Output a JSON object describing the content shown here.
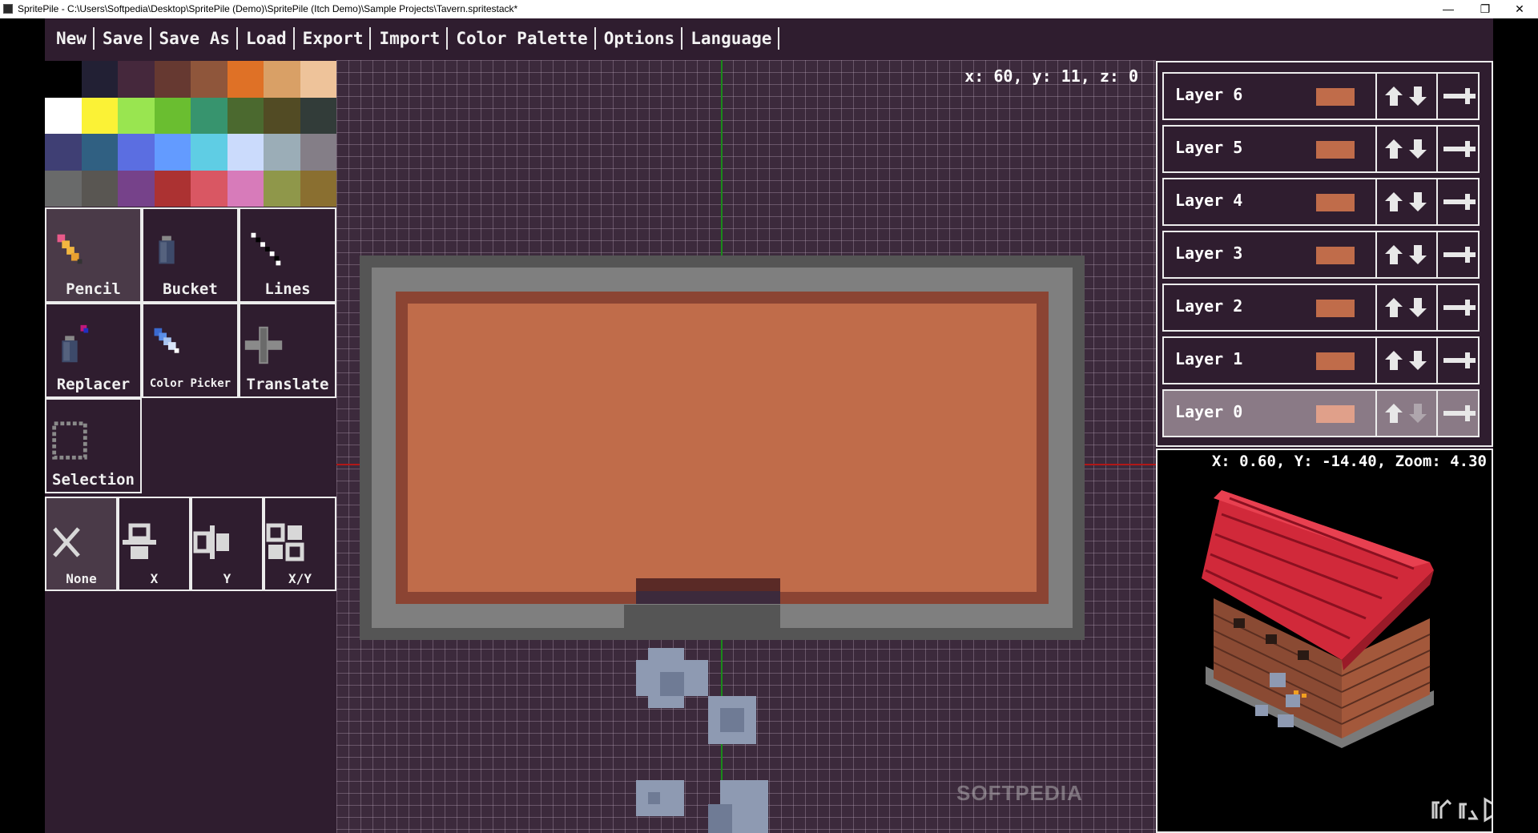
{
  "window": {
    "title": "SpritePile - C:\\Users\\Softpedia\\Desktop\\SpritePile (Demo)\\SpritePile (Itch Demo)\\Sample Projects\\Tavern.spritestack*",
    "minimize": "—",
    "maximize": "❐",
    "close": "✕"
  },
  "menu": [
    "New",
    "Save",
    "Save As",
    "Load",
    "Export",
    "Import",
    "Color Palette",
    "Options",
    "Language"
  ],
  "palette": [
    "#000000",
    "#222034",
    "#45283c",
    "#663931",
    "#8f563b",
    "#df7126",
    "#d9a066",
    "#eec39a",
    "#ffffff",
    "#fbf236",
    "#99e550",
    "#6abe30",
    "#37946e",
    "#4b692f",
    "#524b24",
    "#323c39",
    "#3f3f74",
    "#306082",
    "#5b6ee1",
    "#639bff",
    "#5fcde4",
    "#cbdbfc",
    "#9badb7",
    "#847e87",
    "#696a6a",
    "#595652",
    "#76428a",
    "#ac3232",
    "#d95763",
    "#d77bba",
    "#8f974a",
    "#8a6f30"
  ],
  "tools": [
    {
      "label": "Pencil",
      "icon": "pencil-icon",
      "selected": true
    },
    {
      "label": "Bucket",
      "icon": "bucket-icon",
      "selected": false
    },
    {
      "label": "Lines",
      "icon": "lines-icon",
      "selected": false
    },
    {
      "label": "Replacer",
      "icon": "replacer-icon",
      "selected": false
    },
    {
      "label": "Color Picker",
      "icon": "color-picker-icon",
      "selected": false
    },
    {
      "label": "Translate",
      "icon": "translate-icon",
      "selected": false
    },
    {
      "label": "Selection",
      "icon": "selection-icon",
      "selected": false
    }
  ],
  "mirror": [
    {
      "label": "None",
      "icon": "mirror-none-icon",
      "selected": true
    },
    {
      "label": "X",
      "icon": "mirror-x-icon",
      "selected": false
    },
    {
      "label": "Y",
      "icon": "mirror-y-icon",
      "selected": false
    },
    {
      "label": "X/Y",
      "icon": "mirror-xy-icon",
      "selected": false
    }
  ],
  "canvas": {
    "coords": "x: 60, y: 11, z: 0",
    "watermark": "SOFTPEDIA"
  },
  "layers": [
    {
      "name": "Layer 6",
      "selected": false
    },
    {
      "name": "Layer 5",
      "selected": false
    },
    {
      "name": "Layer 4",
      "selected": false
    },
    {
      "name": "Layer 3",
      "selected": false
    },
    {
      "name": "Layer 2",
      "selected": false
    },
    {
      "name": "Layer 1",
      "selected": false
    },
    {
      "name": "Layer 0",
      "selected": true
    }
  ],
  "preview": {
    "status": "X: 0.60, Y: -14.40, Zoom: 4.30"
  },
  "colors": {
    "bg": "#2f1d2f",
    "grid_bg": "#3c2a3c",
    "floor": "#c06c4a",
    "border": "#8b4433",
    "roof": "#d1293a"
  }
}
